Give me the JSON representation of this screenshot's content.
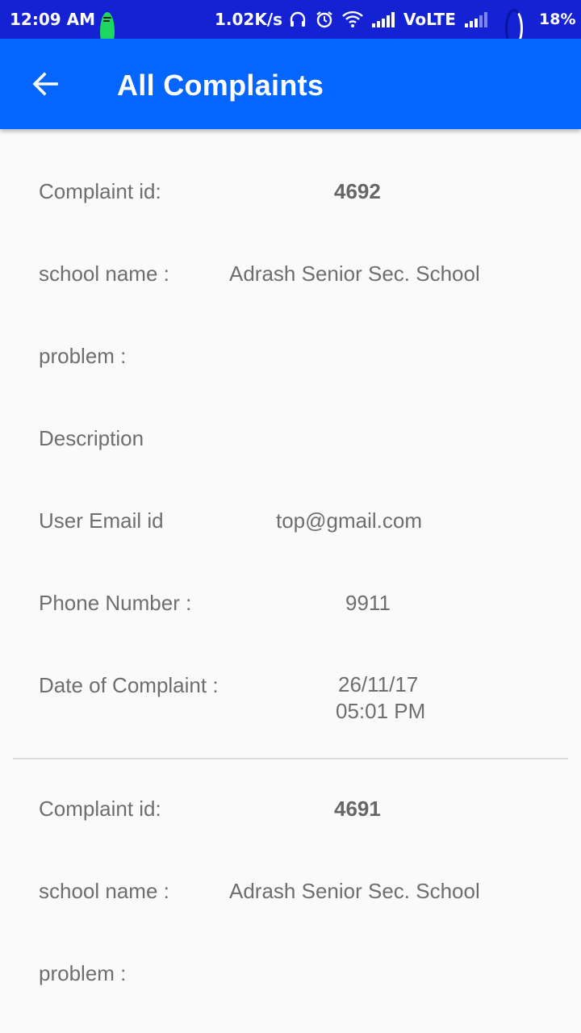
{
  "status_bar": {
    "time": "12:09 AM",
    "network_speed": "1.02K/s",
    "network_type": "VoLTE",
    "battery": "18%",
    "icons": [
      "spotify-icon",
      "headset-icon",
      "alarm-icon",
      "wifi-icon",
      "signal-icon",
      "signal-icon",
      "sync-icon"
    ]
  },
  "app_bar": {
    "title": "All Complaints",
    "back_icon": "arrow-back-icon",
    "color": "#0466ff"
  },
  "complaints": [
    {
      "id_label": "Complaint id:",
      "id": "4692",
      "school_label": "school name :",
      "school": "Adrash Senior Sec. School",
      "problem_label": "problem :",
      "problem": "",
      "description_label": "Description",
      "description": "",
      "email_label": "User Email id",
      "email": "top@gmail.com",
      "phone_label": "Phone Number :",
      "phone": "9911",
      "date_label": "Date of Complaint :",
      "date": "26/11/17",
      "time": "05:01 PM"
    },
    {
      "id_label": "Complaint id:",
      "id": "4691",
      "school_label": "school name :",
      "school": "Adrash Senior Sec. School",
      "problem_label": "problem :",
      "problem": ""
    }
  ]
}
